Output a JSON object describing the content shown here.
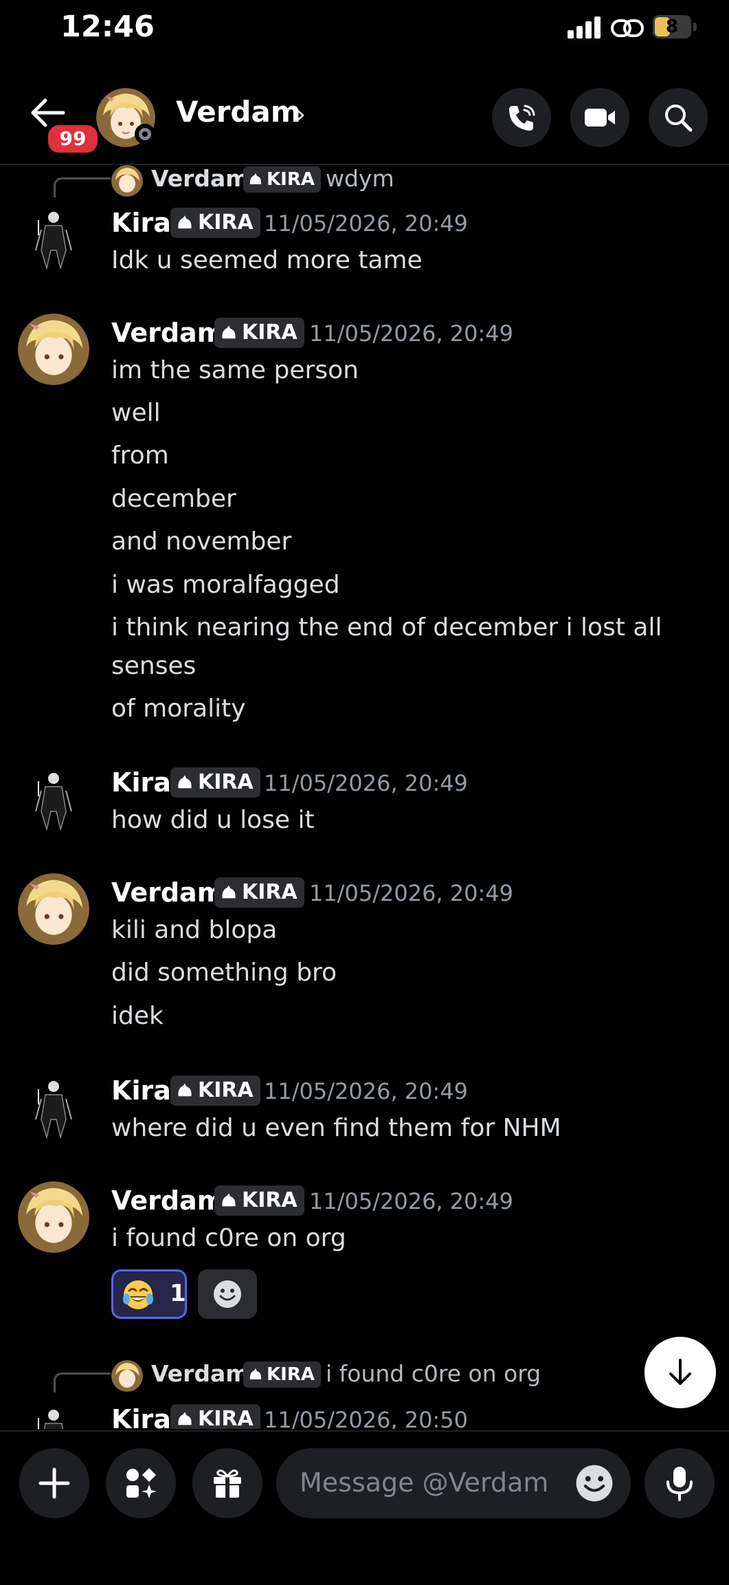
{
  "status_bar": {
    "time": "12:46",
    "battery": "8"
  },
  "header": {
    "unread_count": "99",
    "title": "Verdam",
    "chevron": "›"
  },
  "messages": [
    {
      "type": "reply",
      "author": "Verdam",
      "tag": "KIRA",
      "text": "wdym"
    },
    {
      "type": "message",
      "author": "Kira",
      "tag": "KIRA",
      "timestamp": "11/05/2026, 20:49",
      "lines": [
        "Idk u seemed more tame"
      ]
    },
    {
      "type": "message",
      "author": "Verdam",
      "tag": "KIRA",
      "timestamp": "11/05/2026, 20:49",
      "lines": [
        "im the same person",
        "well",
        "from",
        "december",
        "and november",
        "i was moralfagged",
        "i think nearing the end of december i lost all",
        "senses",
        "of morality"
      ]
    },
    {
      "type": "message",
      "author": "Kira",
      "tag": "KIRA",
      "timestamp": "11/05/2026, 20:49",
      "lines": [
        "how did u lose it"
      ]
    },
    {
      "type": "message",
      "author": "Verdam",
      "tag": "KIRA",
      "timestamp": "11/05/2026, 20:49",
      "lines": [
        "kili and blopa",
        "did something bro",
        "idek"
      ]
    },
    {
      "type": "message",
      "author": "Kira",
      "tag": "KIRA",
      "timestamp": "11/05/2026, 20:49",
      "lines": [
        "where did u even find them for NHM"
      ]
    },
    {
      "type": "message",
      "author": "Verdam",
      "tag": "KIRA",
      "timestamp": "11/05/2026, 20:49",
      "lines": [
        "i found c0re on org"
      ],
      "reaction": {
        "emoji": "joy-emoji",
        "count": "1"
      }
    },
    {
      "type": "reply",
      "author": "Verdam",
      "tag": "KIRA",
      "text": "i found c0re on org"
    },
    {
      "type": "message",
      "author": "Kira",
      "tag": "KIRA",
      "timestamp": "11/05/2026, 20:50",
      "lines": []
    }
  ],
  "composer": {
    "placeholder": "Message @Verdam"
  },
  "colors": {
    "accent": "#5865f2",
    "badge": "#e0313b",
    "background": "#000000"
  },
  "icons": [
    "back-arrow-icon",
    "phone-call-icon",
    "video-camera-icon",
    "search-icon",
    "plus-icon",
    "apps-icon",
    "gift-icon",
    "emoji-icon",
    "microphone-icon",
    "arrow-down-icon"
  ]
}
